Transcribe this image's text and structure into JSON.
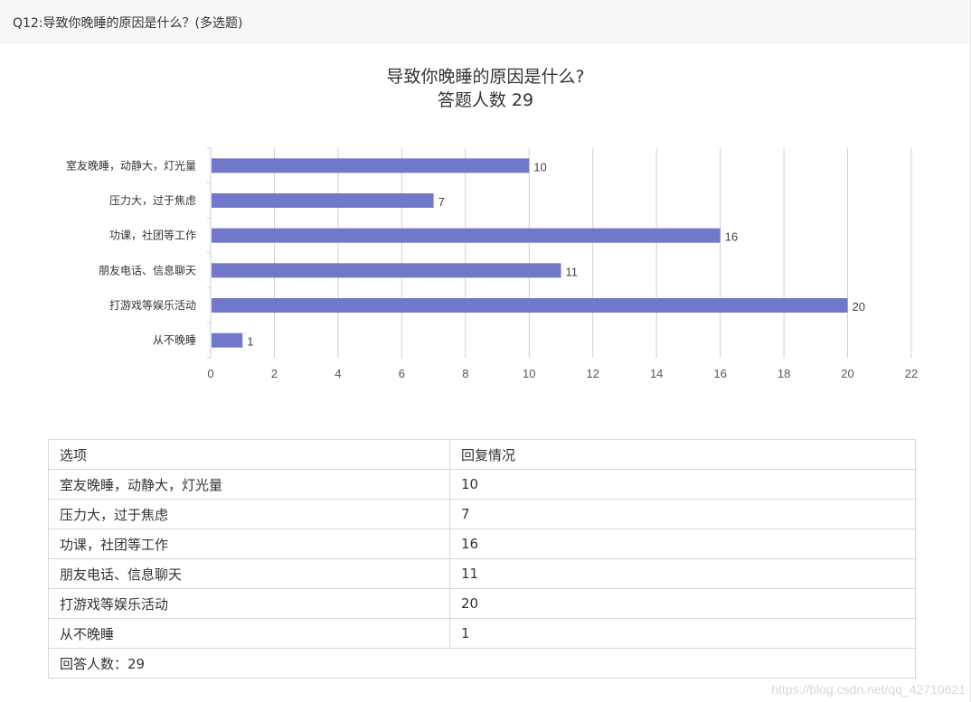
{
  "question": {
    "header": "Q12:导致你晚睡的原因是什么？(多选题)"
  },
  "chart_data": {
    "type": "bar",
    "orientation": "horizontal",
    "title": "导致你晚睡的原因是什么?",
    "subtitle": "答题人数 29",
    "categories": [
      "室友晚睡，动静大，灯光量",
      "压力大，过于焦虑",
      "功课，社团等工作",
      "朋友电话、信息聊天",
      "打游戏等娱乐活动",
      "从不晚睡"
    ],
    "values": [
      10,
      7,
      16,
      11,
      20,
      1
    ],
    "xlim": [
      0,
      22
    ],
    "xticks": [
      0,
      2,
      4,
      6,
      8,
      10,
      12,
      14,
      16,
      18,
      20,
      22
    ],
    "grid": true,
    "bar_color": "#7178c9"
  },
  "table": {
    "headers": [
      "选项",
      "回复情况"
    ],
    "rows": [
      [
        "室友晚睡，动静大，灯光量",
        "10"
      ],
      [
        "压力大，过于焦虑",
        "7"
      ],
      [
        "功课，社团等工作",
        "16"
      ],
      [
        "朋友电话、信息聊天",
        "11"
      ],
      [
        "打游戏等娱乐活动",
        "20"
      ],
      [
        "从不晚睡",
        "1"
      ]
    ],
    "footer": "回答人数：29"
  },
  "watermark": "https://blog.csdn.net/qq_42710621"
}
